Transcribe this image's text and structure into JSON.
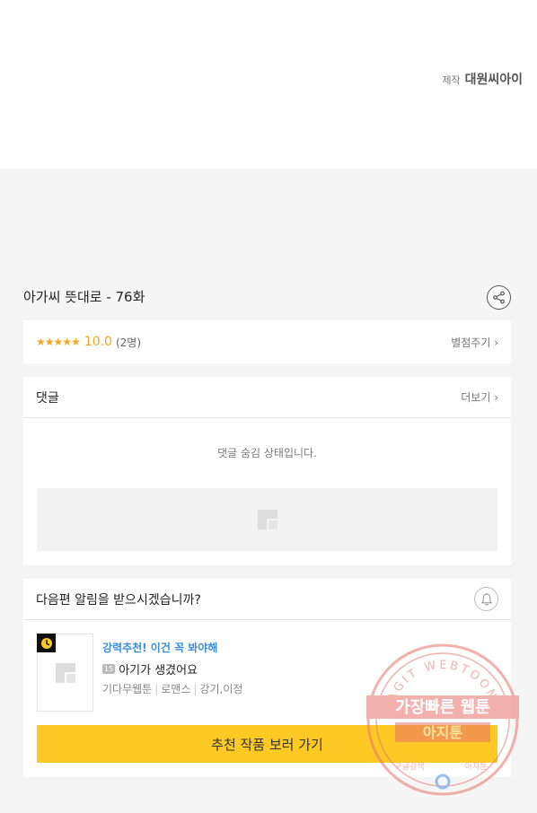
{
  "producer": {
    "label": "제작",
    "name": "대원씨아이"
  },
  "episode": {
    "title": "아가씨 뜻대로 - 76화"
  },
  "icons": {
    "share": "share-icon",
    "bell": "bell-icon",
    "clock": "clock-icon",
    "placeholder": "image-placeholder-icon"
  },
  "rating": {
    "stars": "★★★★★",
    "score": "10.0",
    "count": "(2명)",
    "rate_link": "별점주기 ›"
  },
  "comments": {
    "title": "댓글",
    "more": "더보기 ›",
    "status": "댓글 숨김 상태입니다."
  },
  "notify": {
    "question": "다음편 알림을 받으시겠습니까?",
    "recommend": {
      "tag": "강력추천! 이건 꼭 봐야해",
      "age": "15",
      "title": "아기가 생겼어요",
      "meta": [
        "기다무웹툰",
        "로맨스",
        "강기,이정"
      ],
      "button": "추천 작품 보러 가기"
    }
  },
  "watermark": {
    "arc": "AGIT WEBTOON",
    "line1": "가장빠른 웹툰",
    "line2": "아지툰",
    "bottom_left": "구글검색",
    "bottom_right": "아지툰"
  },
  "colors": {
    "accent_yellow": "#ffc925",
    "star": "#f5a623",
    "link_blue": "#3a8de0",
    "watermark": "#e8736b"
  }
}
